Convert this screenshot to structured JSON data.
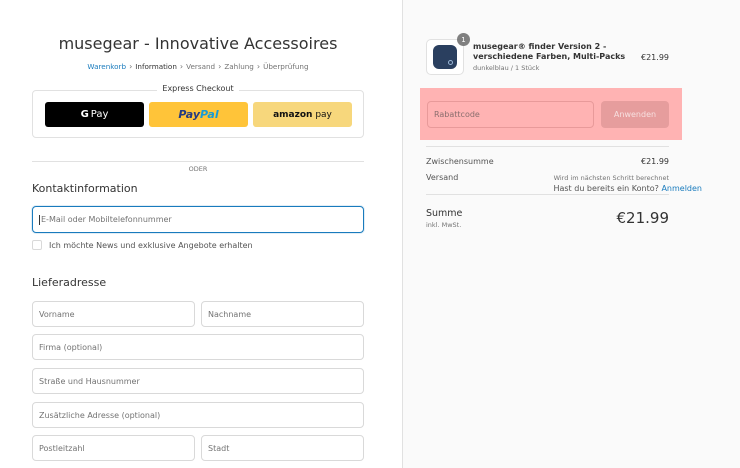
{
  "shop": {
    "title": "musegear - Innovative Accessoires"
  },
  "breadcrumb": [
    "Warenkorb",
    "Information",
    "Versand",
    "Zahlung",
    "Überprüfung"
  ],
  "express": {
    "title": "Express Checkout",
    "gpay_g": "G",
    "gpay_label": "Pay",
    "paypal_pay": "Pay",
    "paypal_pal": "Pal",
    "amazon_brand": "amazon",
    "amazon_pay": "pay"
  },
  "divider_text": "ODER",
  "contact": {
    "heading": "Kontaktinformation",
    "account_question": "Hast du bereits ein Konto?",
    "login_link": "Anmelden",
    "email_placeholder": "E-Mail oder Mobiltelefonnummer",
    "newsletter_label": "Ich möchte News und exklusive Angebote erhalten"
  },
  "shipping": {
    "heading": "Lieferadresse",
    "firstname": "Vorname",
    "lastname": "Nachname",
    "company": "Firma (optional)",
    "street": "Straße und Hausnummer",
    "address2": "Zusätzliche Adresse (optional)",
    "zip": "Postleitzahl",
    "city": "Stadt"
  },
  "cart": {
    "quantity": "1",
    "product_name": "musegear® finder Version 2 - verschiedene Farben, Multi-Packs",
    "product_variant": "dunkelblau / 1 Stück",
    "product_price": "€21.99",
    "discount_placeholder": "Rabattcode",
    "discount_button": "Anwenden",
    "subtotal_label": "Zwischensumme",
    "subtotal_value": "€21.99",
    "shipping_label": "Versand",
    "shipping_value": "Wird im nächsten Schritt berechnet",
    "total_label": "Summe",
    "total_tax": "inkl. MwSt.",
    "total_value": "€21.99"
  },
  "colors": {
    "accent": "#197bbd",
    "paypal_yellow": "#ffc439",
    "highlight": "#ffb3b3"
  }
}
